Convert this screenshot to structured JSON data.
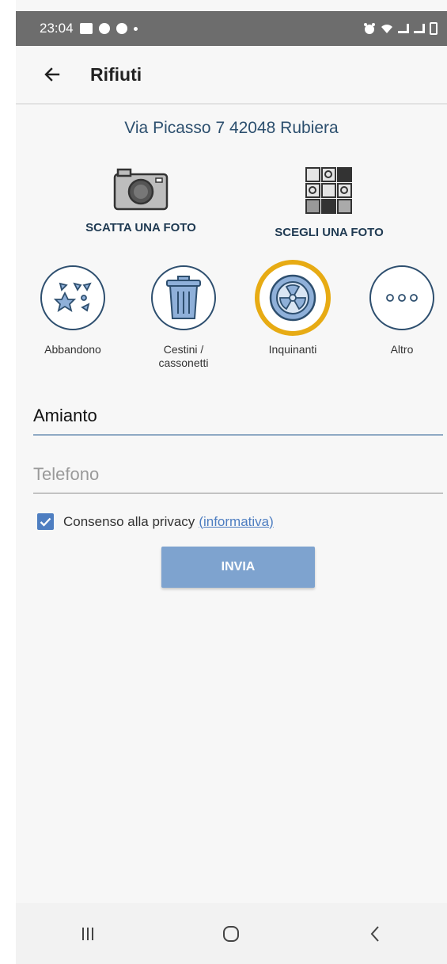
{
  "status_bar": {
    "time": "23:04",
    "left_icons": [
      "gallery-icon",
      "facebook-icon",
      "facebook-icon",
      "dot-icon"
    ],
    "right_icons": [
      "alarm-icon",
      "wifi-icon",
      "signal-icon",
      "signal-icon",
      "battery-icon"
    ]
  },
  "app_bar": {
    "title": "Rifiuti",
    "back_icon": "arrow-left-icon"
  },
  "address": "Via Picasso 7 42048 Rubiera",
  "photo_actions": [
    {
      "label": "SCATTA UNA FOTO",
      "icon": "camera-icon"
    },
    {
      "label": "SCEGLI UNA FOTO",
      "icon": "gallery-grid-icon"
    }
  ],
  "categories": [
    {
      "label": "Abbandono",
      "icon": "scattered-debris-icon",
      "selected": false
    },
    {
      "label": "Cestini / cassonetti",
      "icon": "trash-bin-icon",
      "selected": false
    },
    {
      "label": "Inquinanti",
      "icon": "radiation-icon",
      "selected": true
    },
    {
      "label": "Altro",
      "icon": "more-dots-icon",
      "selected": false
    }
  ],
  "form": {
    "description_value": "Amianto",
    "phone_placeholder": "Telefono",
    "privacy": {
      "checked": true,
      "label": "Consenso alla privacy",
      "link": "(informativa)"
    },
    "submit_label": "INVIA"
  },
  "colors": {
    "accent": "#4e7ec1",
    "selected_ring": "#e7ab14",
    "submit": "#7ea3cf",
    "status_bar": "#6d6d6d"
  },
  "nav_bar": [
    "recents-icon",
    "home-icon",
    "back-icon"
  ]
}
